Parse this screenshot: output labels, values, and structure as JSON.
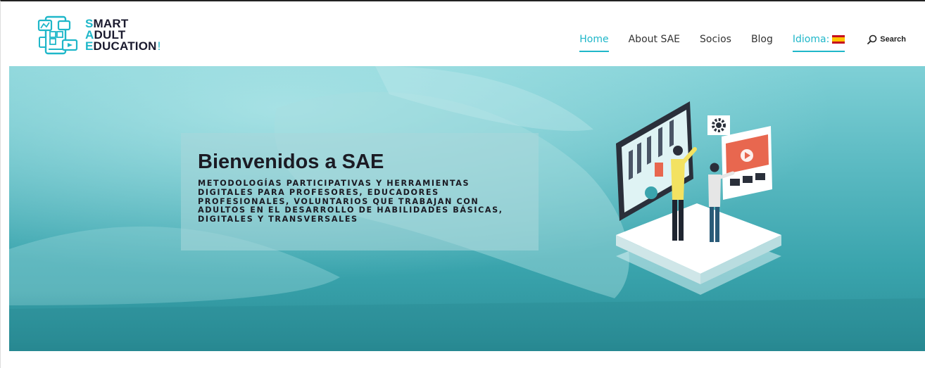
{
  "logo": {
    "lines": [
      {
        "first": "S",
        "rest": "MART"
      },
      {
        "first": "A",
        "rest": "DULT"
      },
      {
        "first": "E",
        "rest": "DUCATION"
      }
    ],
    "bang": "!"
  },
  "nav": {
    "items": [
      {
        "label": "Home",
        "active": true
      },
      {
        "label": "About SAE",
        "active": false
      },
      {
        "label": "Socios",
        "active": false
      },
      {
        "label": "Blog",
        "active": false
      }
    ],
    "language_label": "Idioma:",
    "search_label": "Search"
  },
  "hero": {
    "title_prefix": "Bienvenidos a ",
    "title_strong": "SAE",
    "subtitle": "METODOLOGÍAS PARTICIPATIVAS Y HERRAMIENTAS DIGITALES PARA PROFESORES, EDUCADORES PROFESIONALES, VOLUNTARIOS QUE TRABAJAN CON ADULTOS EN EL DESARROLLO DE HABILIDADES BÁSICAS, DIGITALES Y TRANSVERSALES"
  },
  "colors": {
    "accent": "#1fb7c9",
    "hero_top": "#7fd0d6",
    "hero_bottom": "#2a8f98",
    "text_dark": "#1b1b24"
  },
  "icons": [
    "logo-icon",
    "spain-flag-icon",
    "search-icon",
    "gear-icon",
    "play-icon"
  ]
}
